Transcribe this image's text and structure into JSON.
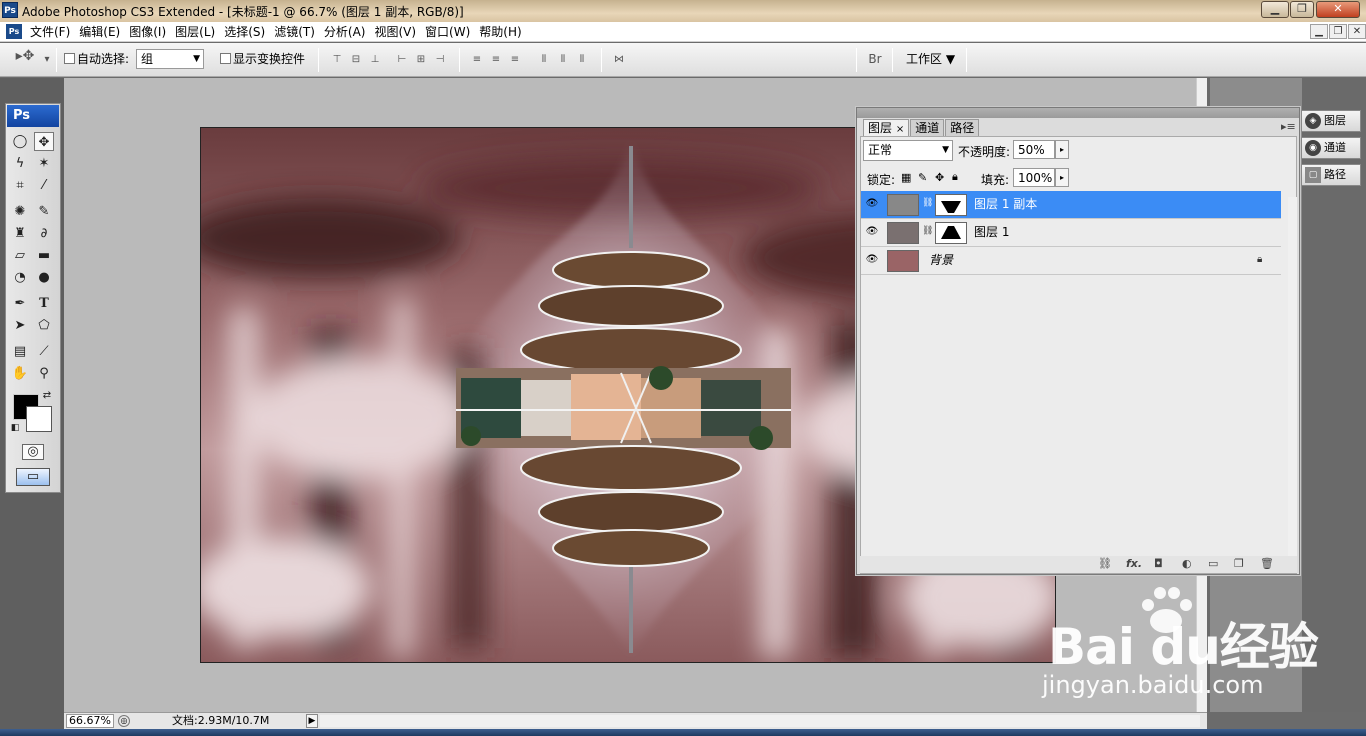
{
  "window": {
    "title": "Adobe Photoshop CS3 Extended - [未标题-1 @ 66.7% (图层 1 副本, RGB/8)]",
    "logo": "Ps"
  },
  "menubar": {
    "items": [
      "文件(F)",
      "编辑(E)",
      "图像(I)",
      "图层(L)",
      "选择(S)",
      "滤镜(T)",
      "分析(A)",
      "视图(V)",
      "窗口(W)",
      "帮助(H)"
    ]
  },
  "options": {
    "auto_select_label": "自动选择:",
    "auto_select_value": "组",
    "show_transform_label": "显示变换控件",
    "workspace_label": "工作区"
  },
  "toolbox": {
    "logo": "Ps"
  },
  "layers_panel": {
    "tabs": [
      "图层",
      "通道",
      "路径"
    ],
    "blend_mode": "正常",
    "opacity_label": "不透明度:",
    "opacity_value": "50%",
    "lock_label": "锁定:",
    "fill_label": "填充:",
    "fill_value": "100%",
    "layers": [
      {
        "name": "图层 1 副本",
        "selected": true,
        "has_mask": true
      },
      {
        "name": "图层 1",
        "selected": false,
        "has_mask": true
      },
      {
        "name": "背景",
        "selected": false,
        "locked": true
      }
    ]
  },
  "dock": {
    "buttons": [
      "图层",
      "通道",
      "路径"
    ]
  },
  "status": {
    "zoom": "66.67%",
    "doc": "文档:2.93M/10.7M"
  },
  "watermark": {
    "brand": "Bai du经验",
    "url": "jingyan.baidu.com"
  }
}
